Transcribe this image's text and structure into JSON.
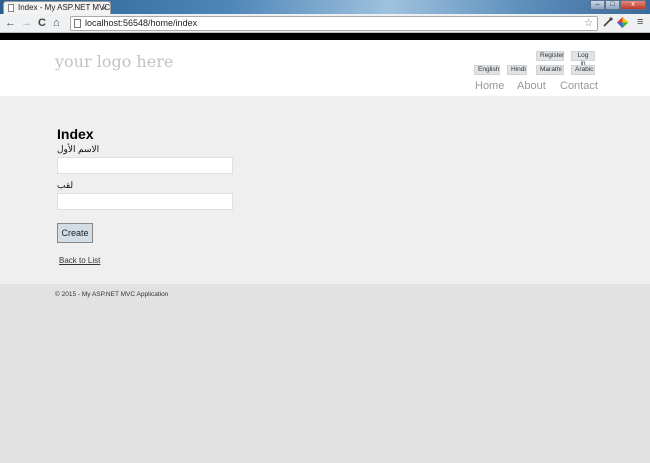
{
  "browser": {
    "tab_title": "Index - My ASP.NET MVC",
    "tab_close": "×",
    "win_min": "–",
    "win_max": "□",
    "win_close": "x",
    "back": "←",
    "forward": "→",
    "reload": "C",
    "home": "⌂",
    "url": "localhost:56548/home/index",
    "star": "☆",
    "menu": "≡"
  },
  "header": {
    "logo": "your logo here",
    "register": "Register",
    "login": "Log in",
    "languages": [
      "English",
      "Hindi",
      "Marathi",
      "Arabic"
    ],
    "menu": [
      "Home",
      "About",
      "Contact"
    ]
  },
  "main": {
    "title": "Index",
    "first_name_label": "الاسم الأول",
    "last_name_label": "لقب",
    "first_name_value": "",
    "last_name_value": "",
    "create_label": "Create",
    "back_link": "Back to List"
  },
  "footer": {
    "text": "© 2015 - My ASP.NET MVC Application"
  },
  "colors": {
    "logo": "#c2c2c2",
    "content_bg": "#efefef",
    "footer_bg": "#e2e2e2",
    "button_bg": "#d3dde5"
  }
}
